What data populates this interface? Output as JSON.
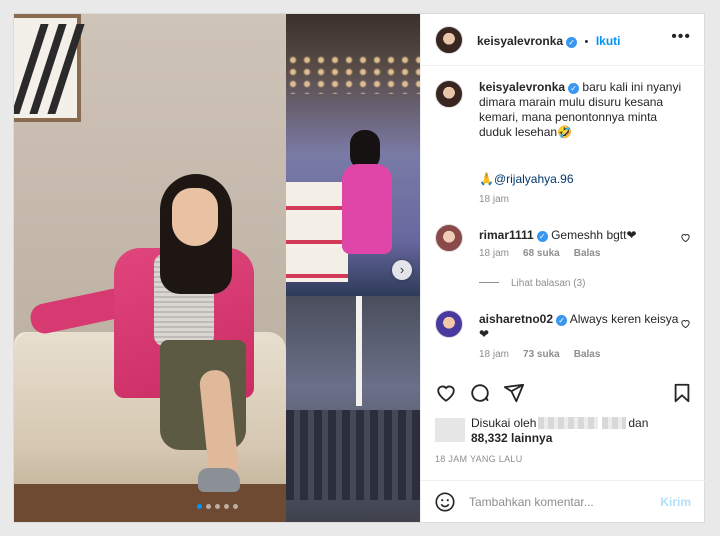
{
  "post": {
    "username": "keisyalevronka",
    "follow_label": "Ikuti",
    "more_label": "•••",
    "separator": "•"
  },
  "caption": {
    "username": "keisyalevronka",
    "text_line1": "baru kali ini nyanyi",
    "text_line2": "dimara marain mulu disuru kesana",
    "text_line3": "kemari, mana penontonnya minta",
    "text_line4": "duduk lesehan🤣",
    "mention": "🙏@rijalyahya.96",
    "time": "18 jam"
  },
  "comments": [
    {
      "username": "rimar1111",
      "text": "Gemeshh bgtt❤",
      "time": "18 jam",
      "likes": "68 suka",
      "reply_label": "Balas",
      "replies_label": "Lihat balasan (3)"
    },
    {
      "username": "aisharetno02",
      "text_line1": "Always keren keisya",
      "text_line2": "❤",
      "time": "18 jam",
      "likes": "73 suka",
      "reply_label": "Balas"
    }
  ],
  "likes": {
    "prefix": "Disukai oleh",
    "and": "dan",
    "others": "88,332 lainnya"
  },
  "time_ago": "18 JAM YANG LALU",
  "add_comment": {
    "placeholder": "Tambahkan komentar...",
    "post_label": "Kirim"
  },
  "carousel": {
    "count": 5,
    "active_index": 0
  },
  "colors": {
    "accent": "#0095f6",
    "verified": "#3897f0",
    "muted": "#8e8e8e"
  }
}
